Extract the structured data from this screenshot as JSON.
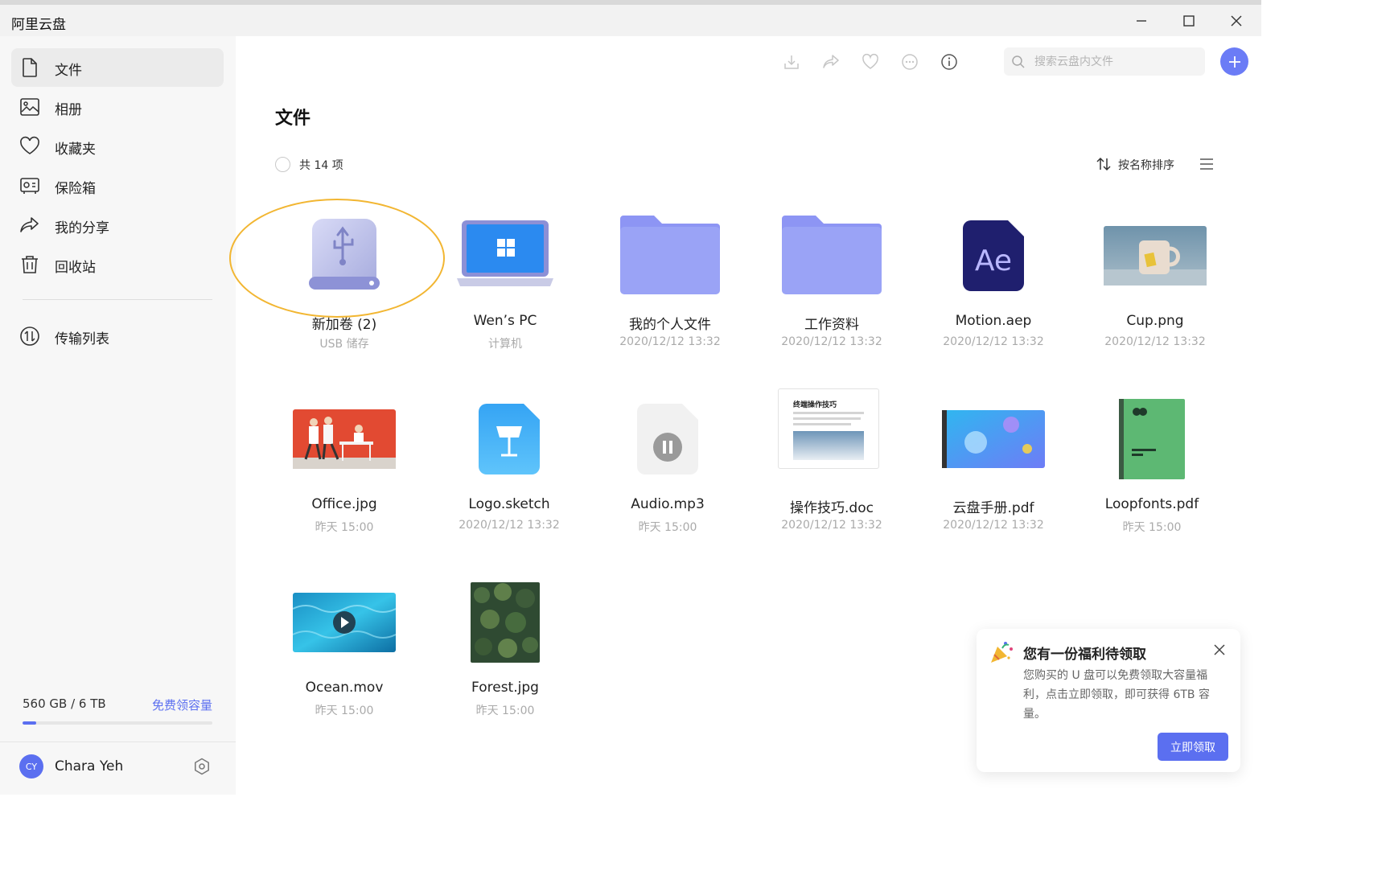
{
  "app": {
    "title": "阿里云盘"
  },
  "colors": {
    "accent": "#5b6ff0",
    "highlight": "#f2b632",
    "sidebar_bg": "#f7f7f7"
  },
  "window_controls": [
    {
      "icon": "minimize-icon"
    },
    {
      "icon": "maximize-icon"
    },
    {
      "icon": "close-icon"
    }
  ],
  "sidebar": {
    "items": [
      {
        "label": "文件",
        "icon": "file-icon",
        "active": true
      },
      {
        "label": "相册",
        "icon": "photo-album-icon"
      },
      {
        "label": "收藏夹",
        "icon": "heart-icon"
      },
      {
        "label": "保险箱",
        "icon": "safe-icon"
      },
      {
        "label": "我的分享",
        "icon": "share-icon"
      },
      {
        "label": "回收站",
        "icon": "trash-icon"
      },
      {
        "label": "传输列表",
        "icon": "transfer-icon"
      }
    ],
    "storage": {
      "used": "560 GB / 6 TB",
      "link": "免费领容量",
      "fraction": 0.07
    },
    "user": {
      "initials": "CY",
      "name": "Chara Yeh",
      "settings_icon": "settings-icon"
    }
  },
  "toolbar": {
    "icons": [
      "download-icon",
      "share-icon",
      "favorite-icon",
      "more-icon",
      "info-icon"
    ],
    "search_placeholder": "搜索云盘内文件",
    "add_icon": "plus-icon"
  },
  "main": {
    "title": "文件",
    "count": "共 14 项",
    "sort_label": "按名称排序",
    "files": [
      {
        "name": "新加卷 (2)",
        "meta": "USB 储存",
        "icon": "usb-drive-icon"
      },
      {
        "name": "Wen’s PC",
        "meta": "计算机",
        "icon": "laptop-icon"
      },
      {
        "name": "我的个人文件",
        "meta": "2020/12/12 13:32",
        "icon": "folder-icon"
      },
      {
        "name": "工作资料",
        "meta": "2020/12/12 13:32",
        "icon": "folder-icon"
      },
      {
        "name": "Motion.aep",
        "meta": "2020/12/12 13:32",
        "icon": "after-effects-icon",
        "badge": "Ae"
      },
      {
        "name": "Cup.png",
        "meta": "2020/12/12 13:32",
        "icon": "cup-image-icon"
      },
      {
        "name": "Office.jpg",
        "meta": "昨天 15:00",
        "icon": "office-image-icon"
      },
      {
        "name": "Logo.sketch",
        "meta": "2020/12/12 13:32",
        "icon": "keynote-icon"
      },
      {
        "name": "Audio.mp3",
        "meta": "昨天 15:00",
        "icon": "audio-icon"
      },
      {
        "name": "操作技巧.doc",
        "meta": "2020/12/12 13:32",
        "icon": "doc-icon",
        "doc_heading": "终端操作技巧"
      },
      {
        "name": "云盘手册.pdf",
        "meta": "2020/12/12 13:32",
        "icon": "pdf-book-icon"
      },
      {
        "name": "Loopfonts.pdf",
        "meta": "昨天 15:00",
        "icon": "green-book-icon"
      },
      {
        "name": "Ocean.mov",
        "meta": "昨天 15:00",
        "icon": "video-icon"
      },
      {
        "name": "Forest.jpg",
        "meta": "昨天 15:00",
        "icon": "forest-image-icon"
      }
    ]
  },
  "toast": {
    "title": "您有一份福利待领取",
    "body": "您购买的 U 盘可以免费领取大容量福利，点击立即领取，即可获得 6TB 容量。",
    "button": "立即领取",
    "icon": "party-popper-icon"
  }
}
